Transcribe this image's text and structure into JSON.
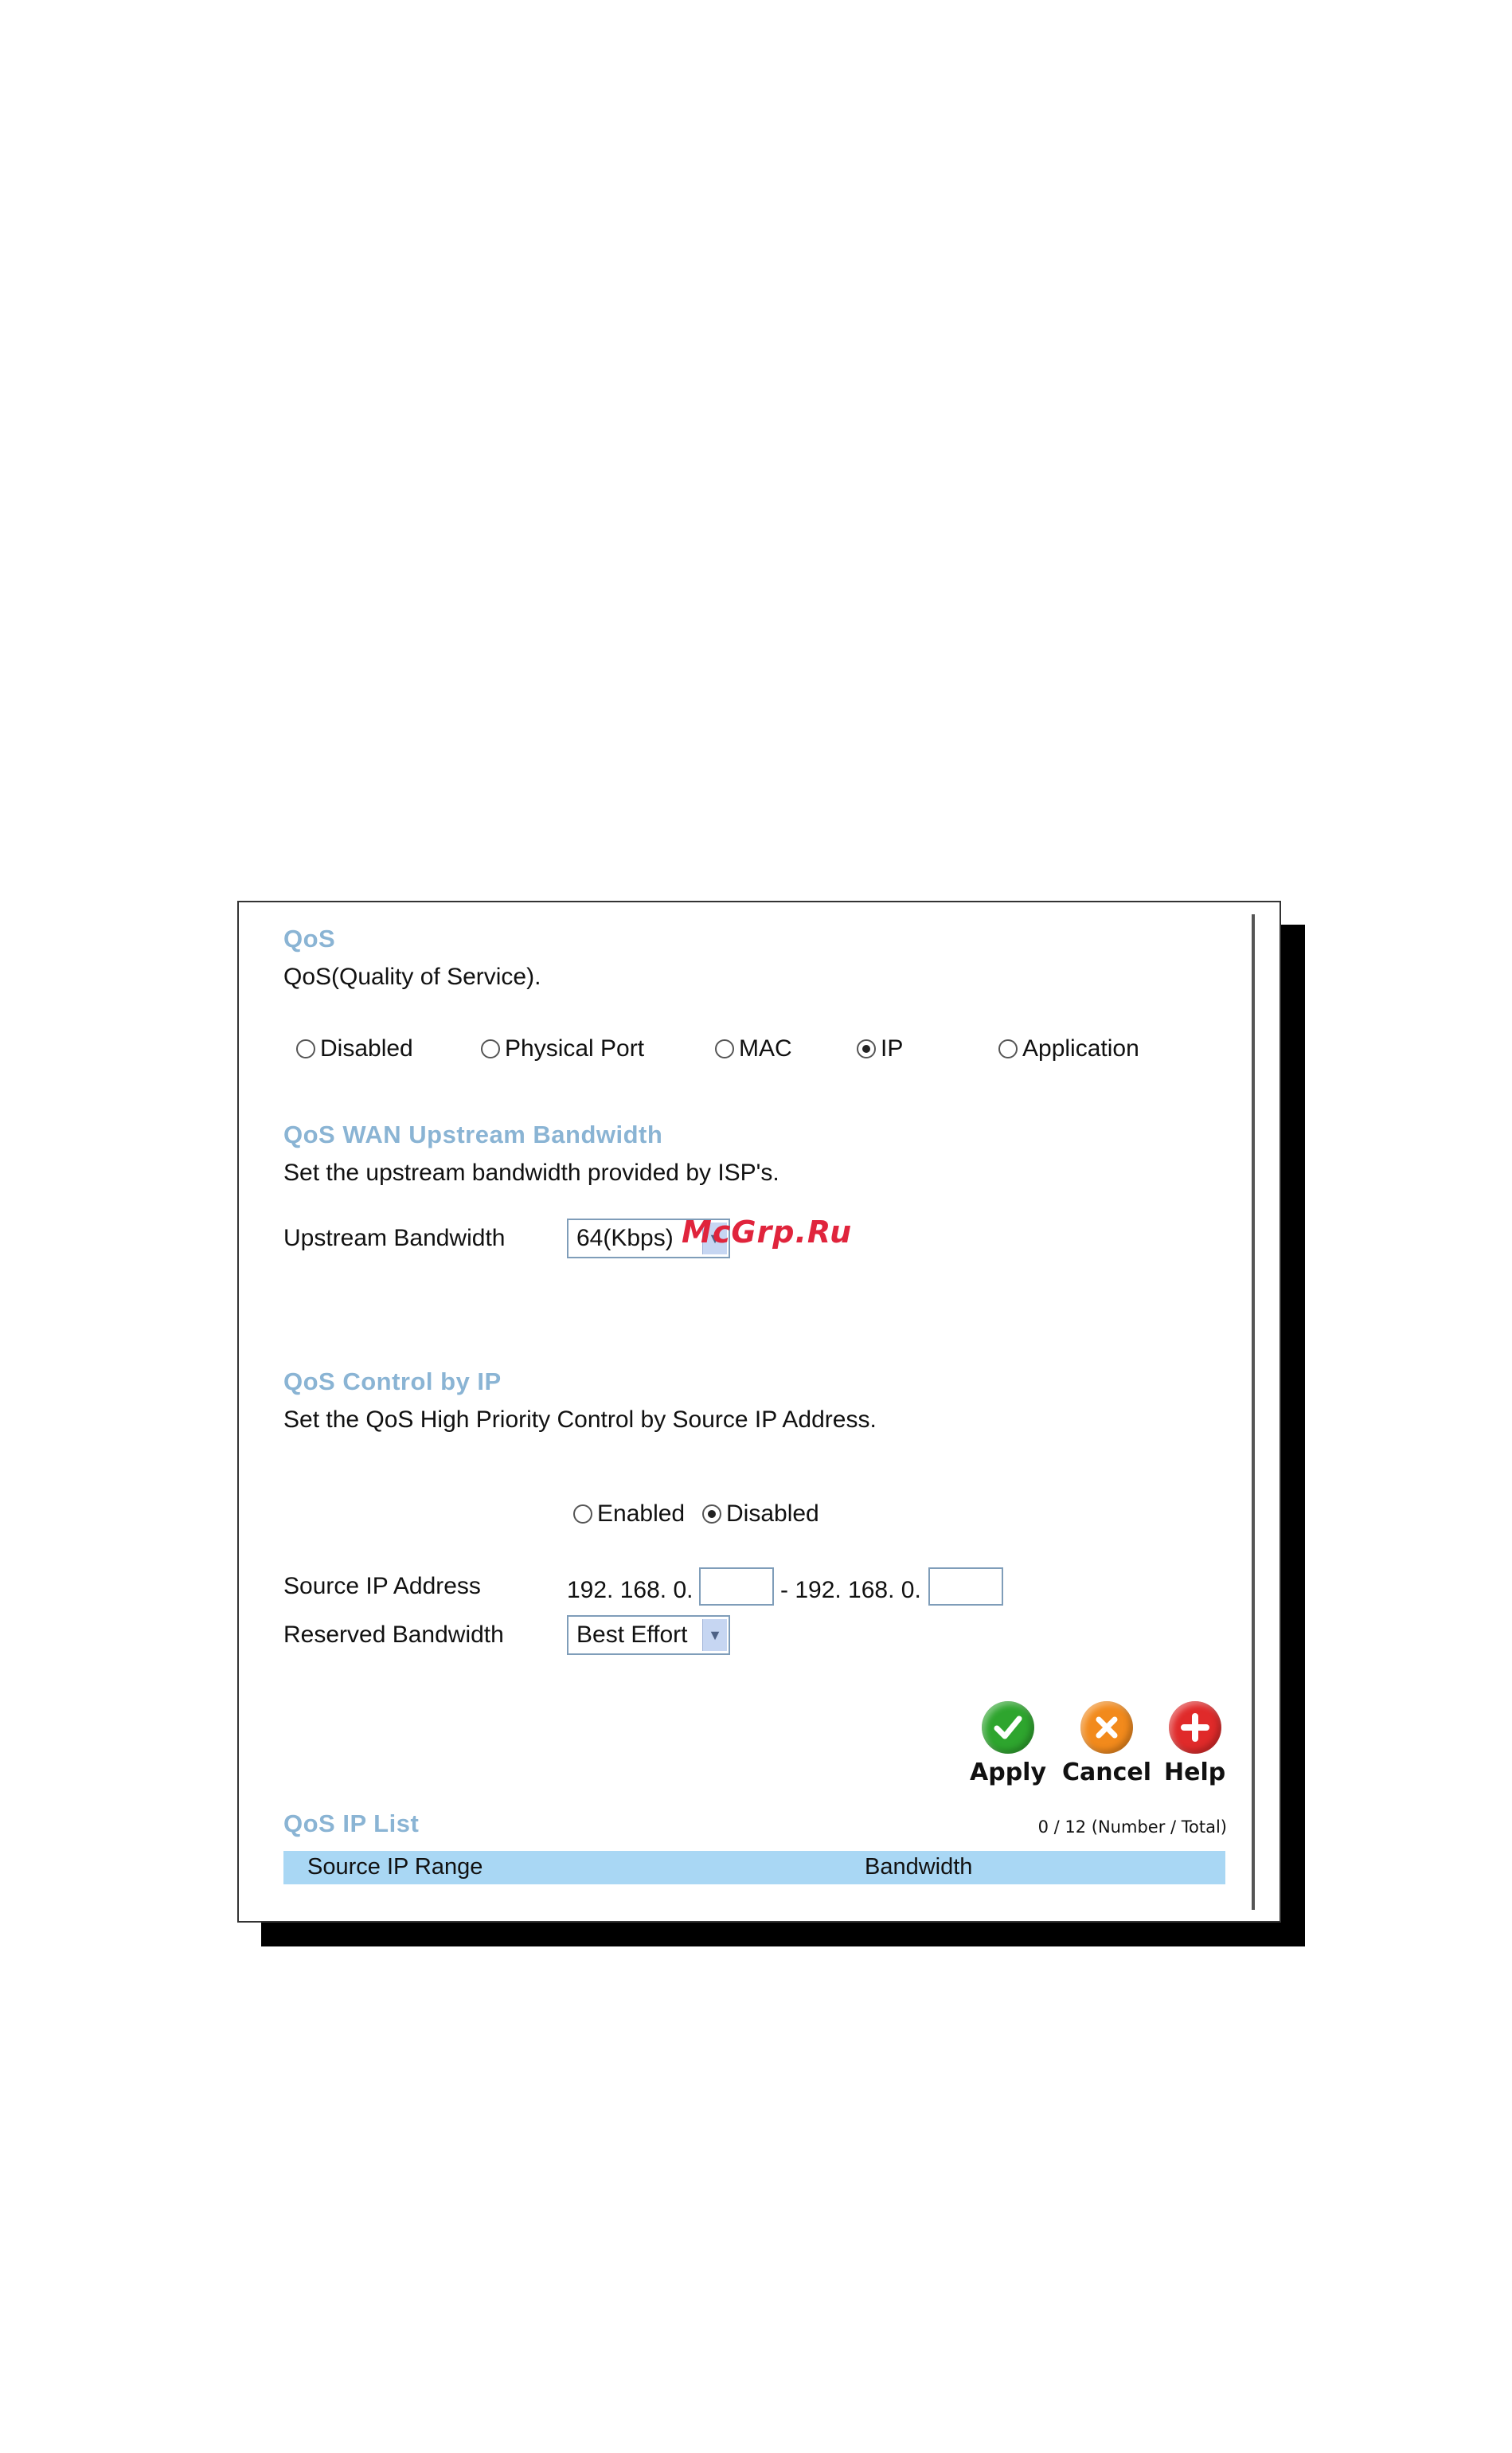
{
  "qos": {
    "title": "QoS",
    "description": "QoS(Quality of Service).",
    "modes": [
      {
        "label": "Disabled",
        "checked": false
      },
      {
        "label": "Physical Port",
        "checked": false
      },
      {
        "label": "MAC",
        "checked": false
      },
      {
        "label": "IP",
        "checked": true
      },
      {
        "label": "Application",
        "checked": false
      }
    ]
  },
  "upstream": {
    "title": "QoS WAN Upstream Bandwidth",
    "description": "Set the upstream bandwidth provided by ISP's.",
    "label": "Upstream Bandwidth",
    "selected": "64(Kbps)"
  },
  "watermark": "McGrp.Ru",
  "control": {
    "title": "QoS Control by IP",
    "description": "Set the QoS High Priority Control by Source IP Address.",
    "enabled_label": "Enabled",
    "disabled_label": "Disabled",
    "selected": "Disabled",
    "source_ip_label": "Source IP Address",
    "ip_prefix_start": "192. 168. 0.",
    "ip_separator": "- 192. 168. 0.",
    "start_value": "",
    "end_value": "",
    "reserved_label": "Reserved Bandwidth",
    "reserved_selected": "Best Effort"
  },
  "buttons": {
    "apply": "Apply",
    "cancel": "Cancel",
    "help": "Help"
  },
  "list": {
    "title": "QoS IP List",
    "count": "0 / 12 (Number / Total)",
    "columns": [
      "Source IP Range",
      "Bandwidth"
    ]
  },
  "colors": {
    "section_title": "#8ab4d4",
    "list_header": "#a9d7f4",
    "apply_icon": "#2ea52e",
    "cancel_icon": "#f28a1c",
    "help_icon": "#e02a2a"
  }
}
